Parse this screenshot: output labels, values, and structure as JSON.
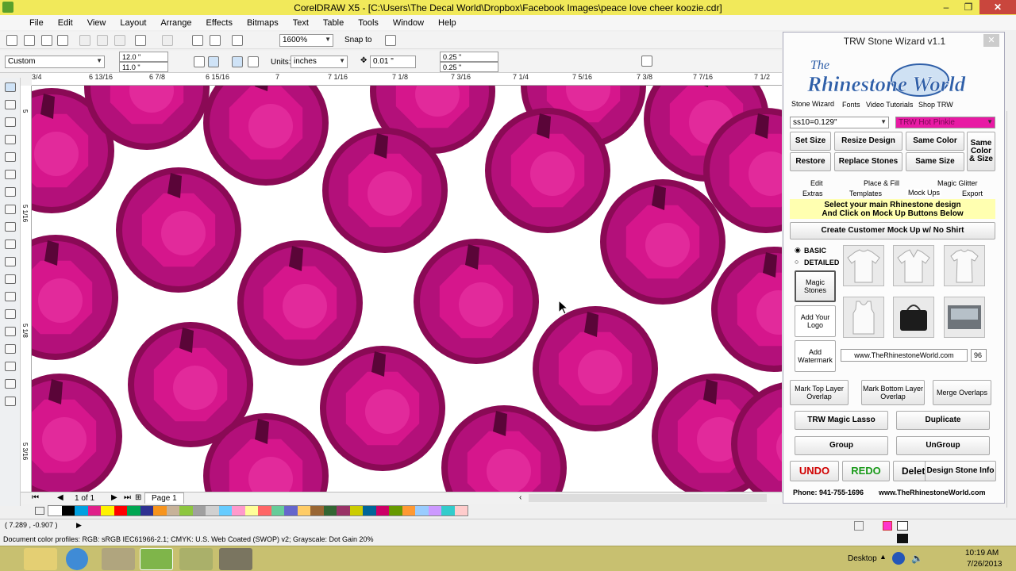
{
  "window": {
    "title": "CorelDRAW X5 - [C:\\Users\\The Decal World\\Dropbox\\Facebook Images\\peace love cheer koozie.cdr]"
  },
  "menu": [
    "File",
    "Edit",
    "View",
    "Layout",
    "Arrange",
    "Effects",
    "Bitmaps",
    "Text",
    "Table",
    "Tools",
    "Window",
    "Help"
  ],
  "toolbar": {
    "zoom": "1600%",
    "snap_to": "Snap to"
  },
  "property_bar": {
    "page_size": "Custom",
    "width": "12.0 \"",
    "height": "11.0 \"",
    "units_label": "Units:",
    "units_value": "inches",
    "nudge": "0.01 \"",
    "dup_x": "0.25 \"",
    "dup_y": "0.25 \""
  },
  "ruler": {
    "top_ticks": [
      "3/4",
      "6 13/16",
      "6 7/8",
      "6 15/16",
      "7",
      "7 1/16",
      "7 1/8",
      "7 3/16",
      "7 1/4",
      "7 5/16",
      "7 3/8",
      "7 7/16",
      "7 1/2"
    ],
    "left_ticks": [
      "5",
      "5 1/16",
      "5 1/8",
      "5 3/16"
    ]
  },
  "page_nav": {
    "count": "1 of 1",
    "page_tab": "Page 1"
  },
  "status": {
    "coords": "( 7.289 , -0.907 )",
    "color_profiles": "Document color profiles: RGB: sRGB IEC61966-2.1; CMYK: U.S. Web Coated (SWOP) v2; Grayscale: Dot Gain 20%"
  },
  "taskbar": {
    "desktop_label": "Desktop",
    "time": "10:19 AM",
    "date": "7/26/2013"
  },
  "panel": {
    "title": "TRW Stone Wizard v1.1",
    "logo_line1": "The",
    "logo_line2": "Rhinestone World",
    "top_tabs": [
      "Stone Wizard",
      "Fonts",
      "Video Tutorials",
      "Shop TRW"
    ],
    "stone_size": "ss10=0.129\"",
    "stone_color": "TRW Hot Pinkie",
    "btn_set_size": "Set Size",
    "btn_resize": "Resize Design",
    "btn_same_color": "Same Color",
    "btn_same_color_size": "Same Color & Size",
    "btn_restore": "Restore",
    "btn_replace": "Replace Stones",
    "btn_same_size": "Same Size",
    "sub_tabs_row1": [
      "Edit",
      "Place & Fill",
      "Magic Glitter"
    ],
    "sub_tabs_row2": [
      "Extras",
      "Templates",
      "Mock Ups",
      "Export"
    ],
    "notice_line1": "Select your main Rhinestone design",
    "notice_line2": "And Click on Mock Up Buttons Below",
    "btn_mockup_noshirt": "Create Customer Mock Up w/ No Shirt",
    "radio_basic": "BASIC",
    "radio_detailed": "DETAILED",
    "btn_magic_stones": "Magic Stones",
    "btn_add_logo": "Add Your Logo",
    "btn_add_watermark": "Add Watermark",
    "watermark_text": "www.TheRhinestoneWorld.com",
    "watermark_size": "96",
    "btn_mark_top": "Mark Top Layer Overlap",
    "btn_mark_bottom": "Mark Bottom Layer Overlap",
    "btn_merge": "Merge Overlaps",
    "btn_magic_lasso": "TRW Magic Lasso",
    "btn_duplicate": "Duplicate",
    "btn_group": "Group",
    "btn_ungroup": "UnGroup",
    "btn_undo": "UNDO",
    "btn_redo": "REDO",
    "btn_delete": "Delete",
    "btn_design_info": "Design Stone Info",
    "footer_phone": "Phone: 941-755-1696",
    "footer_site": "www.TheRhinestoneWorld.com"
  },
  "colors": {
    "stone": "#d6168c",
    "stone_dark": "#8a0a55",
    "title_bar": "#f1e95a",
    "taskbar": "#c8c070",
    "undo": "#d00000",
    "redo": "#1a9a1a"
  }
}
